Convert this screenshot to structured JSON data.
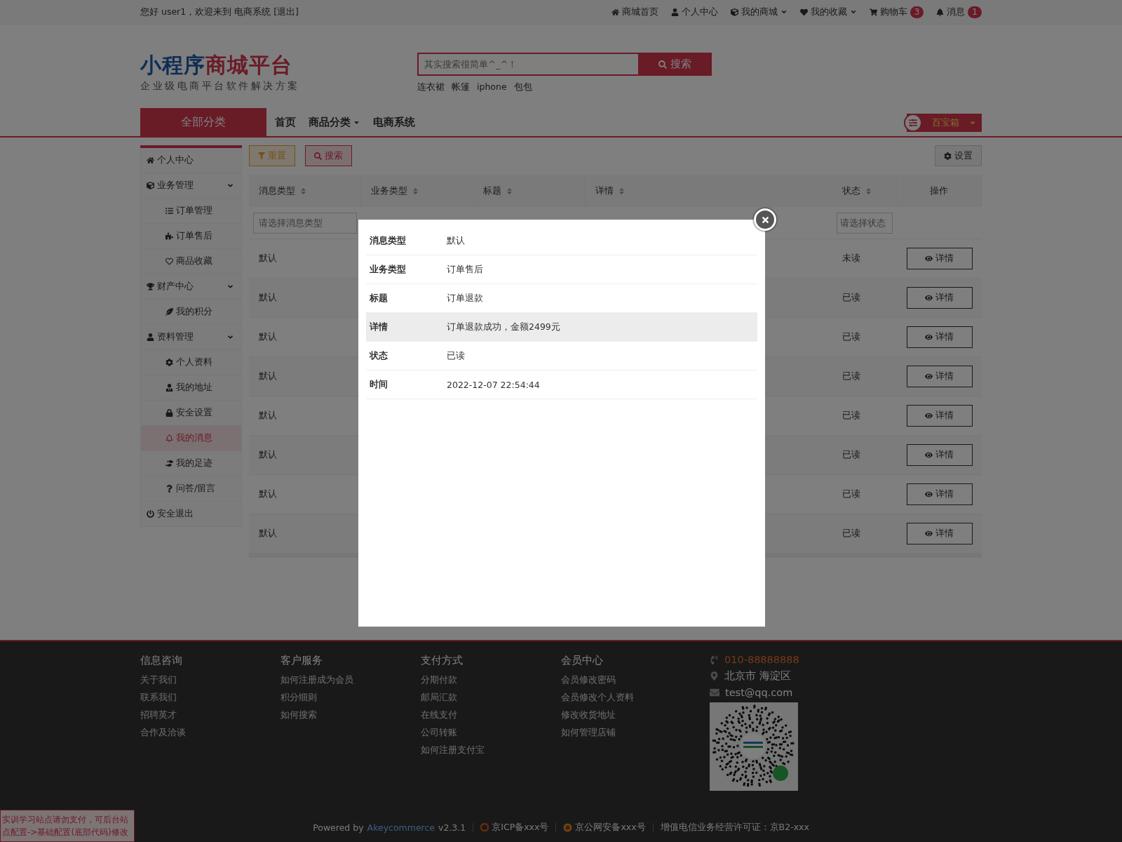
{
  "top_bar": {
    "greeting": "您好 user1，欢迎来到 电商系统",
    "logout": "[退出]",
    "links": [
      {
        "label": "商城首页",
        "dropdown": false
      },
      {
        "label": "个人中心",
        "dropdown": false
      },
      {
        "label": "我的商城",
        "dropdown": true
      },
      {
        "label": "我的收藏",
        "dropdown": true
      },
      {
        "label": "购物车",
        "dropdown": false,
        "badge": "3"
      },
      {
        "label": "消息",
        "dropdown": false,
        "badge": "1"
      }
    ]
  },
  "header": {
    "logo_part_1": "小程序",
    "logo_part_2": "商城平台",
    "tagline": "企业级电商平台软件解决方案",
    "search": {
      "placeholder": "其实搜索很简单^_^！",
      "button": "搜索"
    },
    "hot_words": [
      "连衣裙",
      "帐篷",
      "iphone",
      "包包"
    ]
  },
  "nav": {
    "all_categories": "全部分类",
    "items": [
      {
        "label": "首页",
        "dropdown": false
      },
      {
        "label": "商品分类",
        "dropdown": true
      },
      {
        "label": "电商系统",
        "dropdown": false
      }
    ],
    "toolbox": "百宝箱"
  },
  "sidebar": {
    "items": [
      {
        "label": "个人中心",
        "selected": false
      },
      {
        "label": "业务管理",
        "selected": false,
        "expanded": true,
        "children": [
          {
            "label": "订单管理",
            "selected": false
          },
          {
            "label": "订单售后",
            "selected": false
          },
          {
            "label": "商品收藏",
            "selected": false
          }
        ]
      },
      {
        "label": "财产中心",
        "selected": false,
        "expanded": true,
        "children": [
          {
            "label": "我的积分",
            "selected": false
          }
        ]
      },
      {
        "label": "资料管理",
        "selected": false,
        "expanded": true,
        "children": [
          {
            "label": "个人资料",
            "selected": false
          },
          {
            "label": "我的地址",
            "selected": false
          },
          {
            "label": "安全设置",
            "selected": false
          },
          {
            "label": "我的消息",
            "selected": true
          },
          {
            "label": "我的足迹",
            "selected": false
          },
          {
            "label": "问答/留言",
            "selected": false
          }
        ]
      },
      {
        "label": "安全退出",
        "selected": false
      }
    ]
  },
  "toolbar": {
    "reset": "重置",
    "search": "搜索",
    "settings": "设置"
  },
  "table": {
    "columns": [
      {
        "label": "消息类型",
        "sortable": true
      },
      {
        "label": "业务类型",
        "sortable": true
      },
      {
        "label": "标题",
        "sortable": true
      },
      {
        "label": "详情",
        "sortable": true
      },
      {
        "label": "状态",
        "sortable": true
      },
      {
        "label": "操作",
        "sortable": false
      }
    ],
    "filters": {
      "message_type": {
        "placeholder": "请选择消息类型"
      },
      "status": {
        "placeholder": "请选择状态"
      }
    },
    "rows": [
      {
        "message_type": "默认",
        "status": "未读",
        "action": "详情"
      },
      {
        "message_type": "默认",
        "status": "已读",
        "action": "详情"
      },
      {
        "message_type": "默认",
        "status": "已读",
        "action": "详情"
      },
      {
        "message_type": "默认",
        "status": "已读",
        "action": "详情"
      },
      {
        "message_type": "默认",
        "status": "已读",
        "action": "详情"
      },
      {
        "message_type": "默认",
        "status": "已读",
        "action": "详情"
      },
      {
        "message_type": "默认",
        "status": "已读",
        "action": "详情"
      },
      {
        "message_type": "默认",
        "status": "已读",
        "action": "详情"
      }
    ]
  },
  "modal": {
    "fields": [
      {
        "label": "消息类型",
        "value": "默认",
        "selected": false
      },
      {
        "label": "业务类型",
        "value": "订单售后",
        "selected": false
      },
      {
        "label": "标题",
        "value": "订单退款",
        "selected": false
      },
      {
        "label": "详情",
        "value": "订单退款成功，金额2499元",
        "selected": true
      },
      {
        "label": "状态",
        "value": "已读",
        "selected": false
      },
      {
        "label": "时间",
        "value": "2022-12-07 22:54:44",
        "selected": false
      }
    ]
  },
  "footer": {
    "columns": [
      {
        "title": "信息咨询",
        "links": [
          "关于我们",
          "联系我们",
          "招聘英才",
          "合作及洽谈"
        ]
      },
      {
        "title": "客户服务",
        "links": [
          "如何注册成为会员",
          "积分细则",
          "如何搜索"
        ]
      },
      {
        "title": "支付方式",
        "links": [
          "分期付款",
          "邮局汇款",
          "在线支付",
          "公司转账",
          "如何注册支付宝"
        ]
      },
      {
        "title": "会员中心",
        "links": [
          "会员修改密码",
          "会员修改个人资料",
          "修改收货地址",
          "如何管理店铺"
        ]
      }
    ],
    "contact": {
      "phone": "010-88888888",
      "address": "北京市 海淀区",
      "email": "test@qq.com"
    },
    "powered_by": "Powered by",
    "brand_link": "Akeycommerce",
    "version": "v2.3.1",
    "icp": "京ICP备xxx号",
    "police": "京公网安备xxx号",
    "license": "增值电信业务经营许可证：京B2-xxx"
  },
  "notice": "实训学习站点请勿支付，可后台站点配置->基础配置(底部代码)修改"
}
